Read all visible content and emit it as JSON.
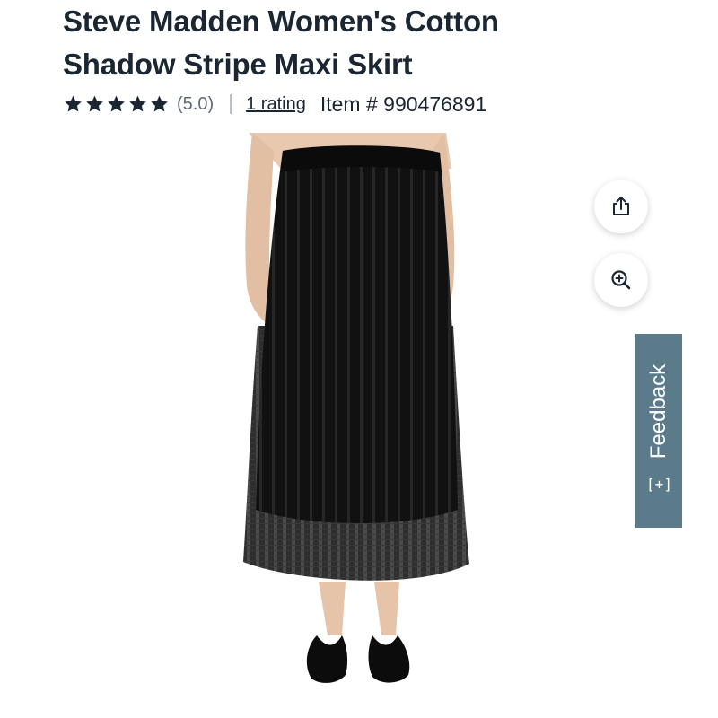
{
  "product": {
    "title_line1": "Steve Madden Women's Cotton",
    "title_line2": "Shadow Stripe Maxi Skirt",
    "rating_value": 5.0,
    "rating_score_text": "(5.0)",
    "rating_count_text": "1 rating",
    "item_number_text": "Item # 990476891"
  },
  "actions": {
    "share_icon": "share-icon",
    "zoom_icon": "zoom-in-icon"
  },
  "feedback": {
    "label": "Feedback",
    "icon_text": "[+]"
  },
  "colors": {
    "text": "#1b2633",
    "star": "#1b2633",
    "feedback_bg": "#5b7a8a"
  }
}
